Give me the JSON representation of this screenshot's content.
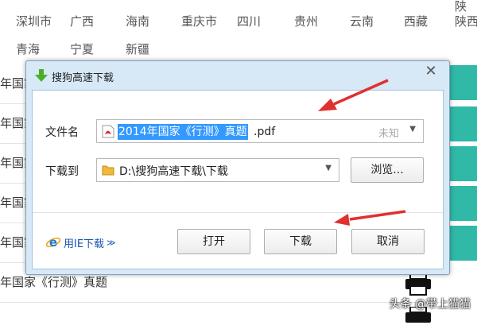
{
  "background": {
    "top_row": [
      "",
      "",
      "",
      "",
      "",
      "",
      "",
      "",
      "陕"
    ],
    "region_row1": [
      "深圳市",
      "广西",
      "海南",
      "重庆市",
      "四川",
      "贵州",
      "云南",
      "西藏",
      "陕西"
    ],
    "region_row2": [
      "青海",
      "宁夏",
      "新疆"
    ],
    "list_rows": [
      "年国家",
      "年国家",
      "年国家",
      "年国家",
      "年国家",
      "年国家《行测》真题"
    ]
  },
  "dialog": {
    "title": "搜狗高速下载",
    "close_symbol": "✕",
    "filename_label": "文件名",
    "filename_selected": "2014年国家《行测》真题",
    "filename_ext": ".pdf",
    "file_size": "未知",
    "save_to_label": "下载到",
    "save_path": "D:\\搜狗高速下载\\下载",
    "browse_button": "浏览...",
    "ie_link": "用IE下载",
    "ie_chevron": "≫",
    "open_button": "打开",
    "download_button": "下载",
    "cancel_button": "取消"
  },
  "watermark": "头条 @带上猫猫",
  "colors": {
    "selection": "#3399ff",
    "annotation_arrow": "#e03030",
    "teal_button": "#2fb9a6",
    "dialog_frame": "#d7e8f6"
  },
  "icons": {
    "title": "download-arrow-icon",
    "file": "pdf-icon",
    "folder": "folder-icon",
    "ie": "ie-icon",
    "printer": "printer-icon"
  }
}
